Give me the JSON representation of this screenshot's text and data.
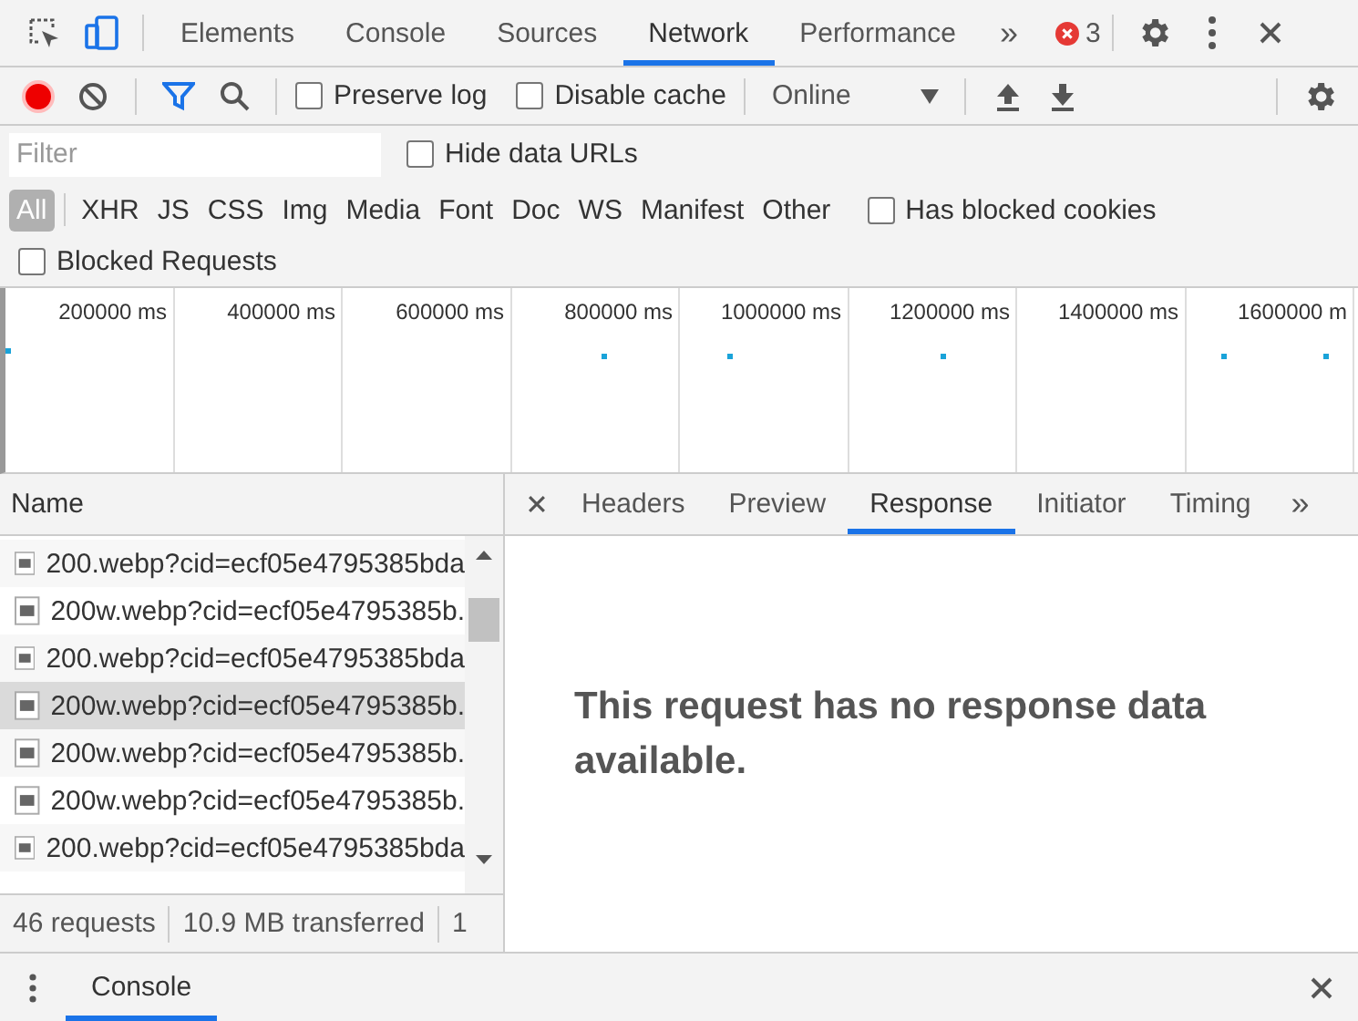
{
  "main_tabs": [
    {
      "label": "Elements",
      "selected": false
    },
    {
      "label": "Console",
      "selected": false
    },
    {
      "label": "Sources",
      "selected": false
    },
    {
      "label": "Network",
      "selected": true
    },
    {
      "label": "Performance",
      "selected": false
    }
  ],
  "more_tabs": "»",
  "error_count": "3",
  "toolbar": {
    "recording": true,
    "preserve_log": {
      "label": "Preserve log",
      "checked": false
    },
    "disable_cache": {
      "label": "Disable cache",
      "checked": false
    },
    "throttling": "Online"
  },
  "filter": {
    "placeholder": "Filter",
    "hide_data_urls": {
      "label": "Hide data URLs",
      "checked": false
    }
  },
  "type_filters": [
    {
      "label": "All",
      "selected": true
    },
    {
      "label": "XHR",
      "selected": false
    },
    {
      "label": "JS",
      "selected": false
    },
    {
      "label": "CSS",
      "selected": false
    },
    {
      "label": "Img",
      "selected": false
    },
    {
      "label": "Media",
      "selected": false
    },
    {
      "label": "Font",
      "selected": false
    },
    {
      "label": "Doc",
      "selected": false
    },
    {
      "label": "WS",
      "selected": false
    },
    {
      "label": "Manifest",
      "selected": false
    },
    {
      "label": "Other",
      "selected": false
    }
  ],
  "has_blocked_cookies": {
    "label": "Has blocked cookies",
    "checked": false
  },
  "blocked_requests": {
    "label": "Blocked Requests",
    "checked": false
  },
  "timeline": {
    "ticks": [
      "200000 ms",
      "400000 ms",
      "600000 ms",
      "800000 ms",
      "1000000 ms",
      "1200000 ms",
      "1400000 ms",
      "1600000 m"
    ]
  },
  "requests": {
    "column": "Name",
    "rows": [
      {
        "name": "200.webp?cid=ecf05e4795385bda",
        "selected": false
      },
      {
        "name": "200w.webp?cid=ecf05e4795385b.",
        "selected": false
      },
      {
        "name": "200.webp?cid=ecf05e4795385bda",
        "selected": false
      },
      {
        "name": "200w.webp?cid=ecf05e4795385b.",
        "selected": true
      },
      {
        "name": "200w.webp?cid=ecf05e4795385b.",
        "selected": false
      },
      {
        "name": "200w.webp?cid=ecf05e4795385b.",
        "selected": false
      },
      {
        "name": "200.webp?cid=ecf05e4795385bda",
        "selected": false
      }
    ]
  },
  "summary": [
    "46 requests",
    "10.9 MB transferred",
    "1"
  ],
  "detail_tabs": [
    {
      "label": "Headers",
      "selected": false
    },
    {
      "label": "Preview",
      "selected": false
    },
    {
      "label": "Response",
      "selected": true
    },
    {
      "label": "Initiator",
      "selected": false
    },
    {
      "label": "Timing",
      "selected": false
    }
  ],
  "detail_more": "»",
  "response_message": "This request has no response data available.",
  "drawer": {
    "tabs": [
      {
        "label": "Console",
        "selected": true
      }
    ]
  }
}
